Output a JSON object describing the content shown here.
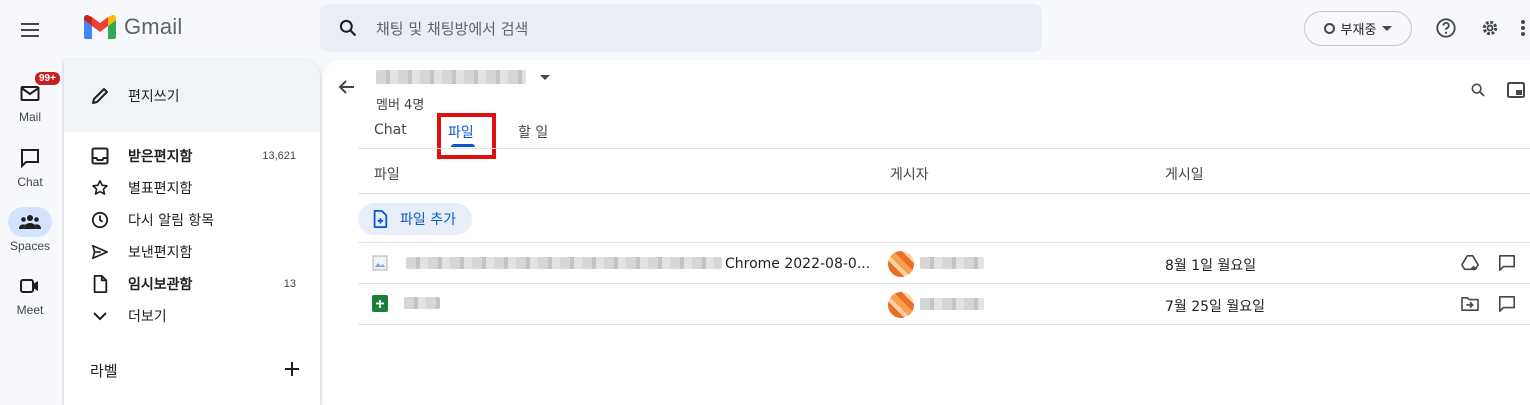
{
  "app": {
    "name": "Gmail"
  },
  "search": {
    "placeholder": "채팅 및 채팅방에서 검색"
  },
  "status": {
    "label": "부재중"
  },
  "rail": [
    {
      "label": "Mail",
      "badge": "99+"
    },
    {
      "label": "Chat"
    },
    {
      "label": "Spaces"
    },
    {
      "label": "Meet"
    }
  ],
  "drawer": {
    "compose": "편지쓰기",
    "items": [
      {
        "label": "받은편지함",
        "count": "13,621",
        "icon": "inbox-icon"
      },
      {
        "label": "별표편지함",
        "count": "",
        "icon": "star-icon"
      },
      {
        "label": "다시 알림 항목",
        "count": "",
        "icon": "clock-icon"
      },
      {
        "label": "보낸편지함",
        "count": "",
        "icon": "send-icon"
      },
      {
        "label": "임시보관함",
        "count": "13",
        "icon": "draft-icon"
      },
      {
        "label": "더보기",
        "count": "",
        "icon": "chevron-down-icon"
      }
    ],
    "labels_heading": "라벨"
  },
  "space": {
    "members": "멤버 4명",
    "tabs": [
      {
        "label": "Chat",
        "active": false
      },
      {
        "label": "파일",
        "active": true
      },
      {
        "label": "할 일",
        "active": false
      }
    ],
    "columns": [
      "파일",
      "게시자",
      "게시일"
    ],
    "add_file": "파일 추가",
    "files": [
      {
        "name_visible": "Chrome 2022-08-0...",
        "date": "8월 1일 월요일",
        "type": "image",
        "action_icon": "add-to-drive-icon"
      },
      {
        "name_visible": "",
        "date": "7월 25일 월요일",
        "type": "sheets",
        "action_icon": "move-to-folder-icon"
      }
    ]
  },
  "colors": {
    "accent": "#0b57d0",
    "highlight": "#e01010",
    "badge": "#c5221f",
    "sheets_green": "#188038"
  }
}
